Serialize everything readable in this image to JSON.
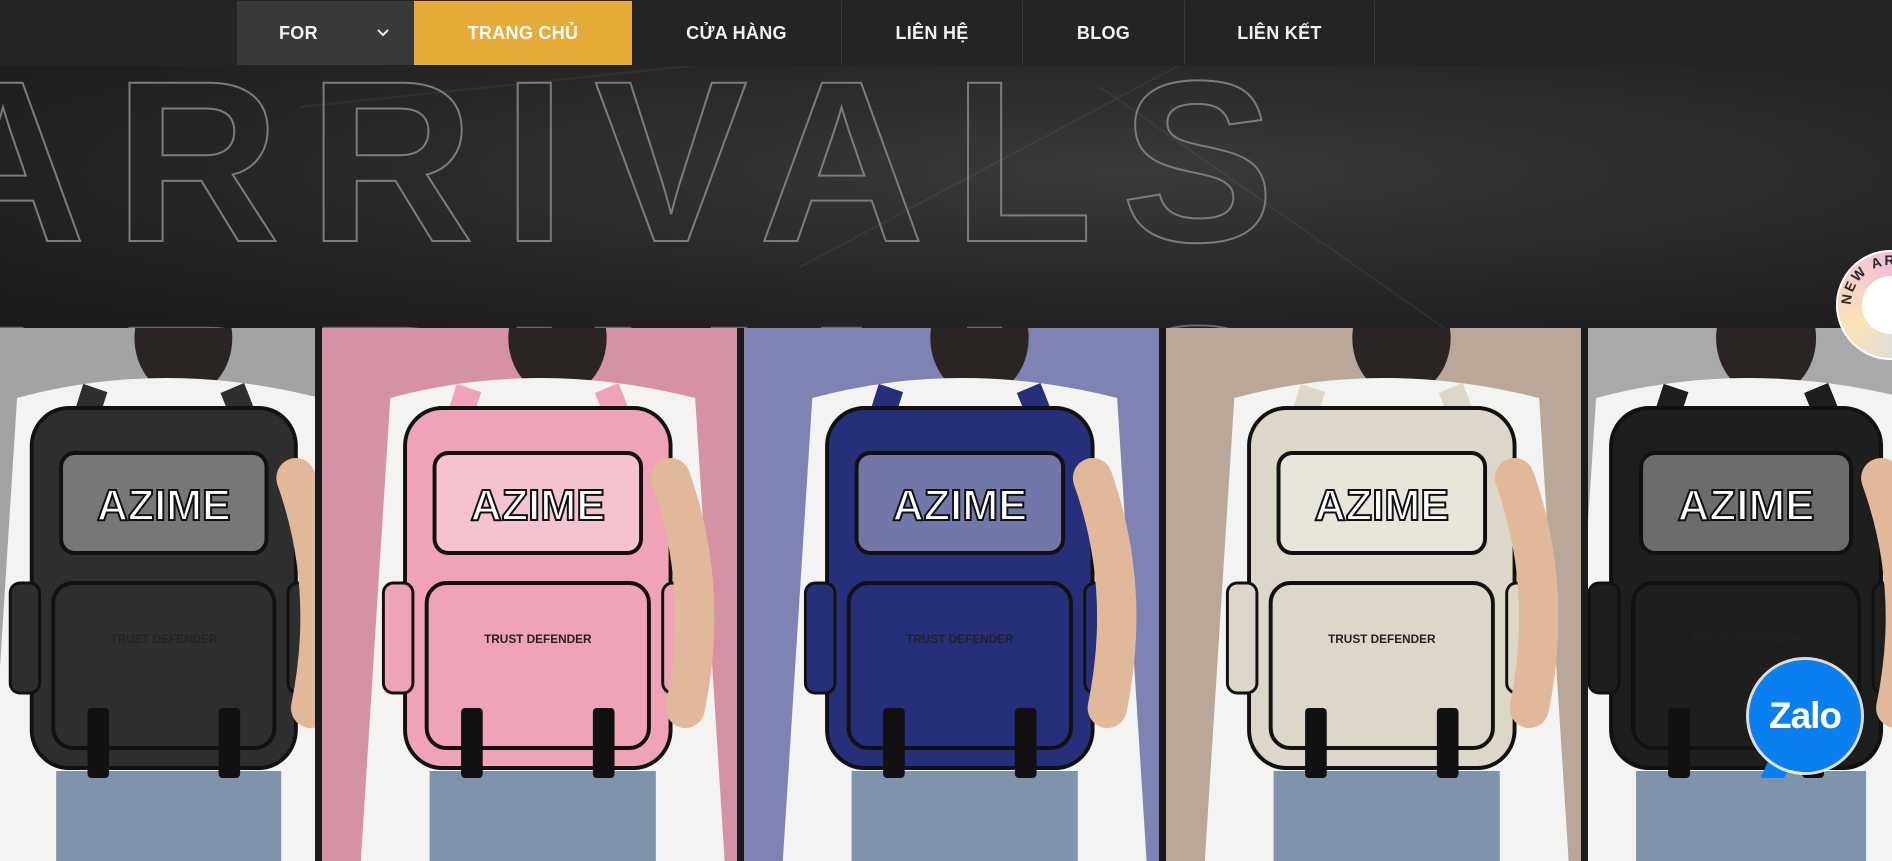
{
  "nav": {
    "for_label": "FOR",
    "items": [
      {
        "label": "TRANG CHỦ"
      },
      {
        "label": "CỬA HÀNG"
      },
      {
        "label": "LIÊN HỆ"
      },
      {
        "label": "BLOG"
      },
      {
        "label": "LIÊN KẾT"
      }
    ]
  },
  "hero": {
    "background_word": "ARRIVALS"
  },
  "panels": [
    {
      "bg": "#a3a3a3",
      "bag": "#2e2e2e",
      "brand": "AZIME",
      "tag": "TRUST DEFENDER"
    },
    {
      "bg": "#d592a5",
      "bag": "#f0a2b6",
      "brand": "AZIME",
      "tag": "TRUST DEFENDER"
    },
    {
      "bg": "#7f83b3",
      "bag": "#262f7a",
      "brand": "AZIME",
      "tag": "TRUST DEFENDER"
    },
    {
      "bg": "#b9a79a",
      "bag": "#dcd7c8",
      "brand": "AZIME",
      "tag": "TRUST DEFENDER"
    },
    {
      "bg": "#a9a9a9",
      "bag": "#1e1e1e",
      "brand": "AZIME",
      "tag": "TRUST DEFENDER"
    }
  ],
  "badge": {
    "text": "NEW ARRIVALS"
  },
  "zalo": {
    "label": "Zalo"
  }
}
